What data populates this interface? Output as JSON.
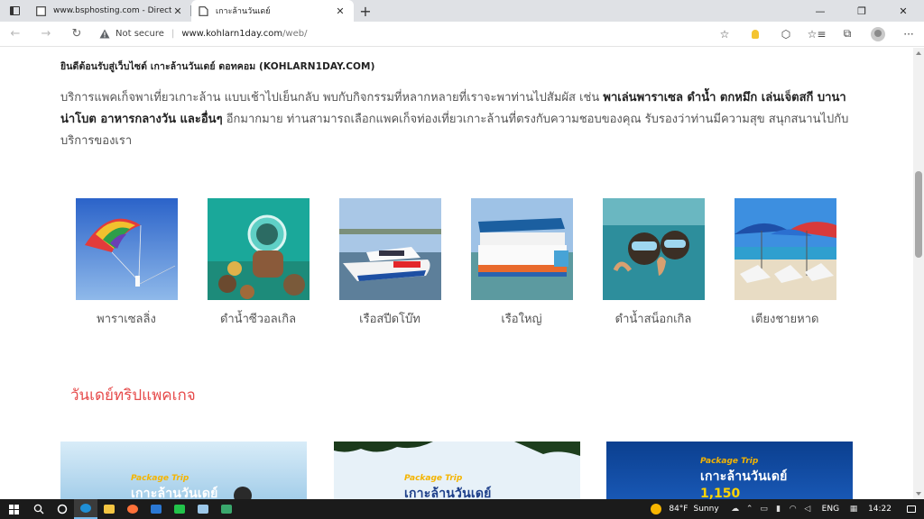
{
  "browser": {
    "tabs": [
      {
        "title": "www.bsphosting.com - DirectAd",
        "active": false,
        "close": "✕"
      },
      {
        "title": "เกาะล้านวันเดย์",
        "active": true,
        "close": "✕"
      }
    ],
    "new_tab": "+",
    "window_controls": {
      "minimize": "—",
      "restore": "❐",
      "close": "✕"
    },
    "nav": {
      "back": "←",
      "forward": "→",
      "reload": "↻"
    },
    "address": {
      "security_label": "Not secure",
      "separator": "|",
      "url_host": "www.kohlarn1day.com",
      "url_path": "/web/"
    },
    "tools": {
      "favorites": "☆",
      "extensions": "⬡",
      "collections": "☆≡",
      "tabs": "⧉",
      "more": "···"
    }
  },
  "page": {
    "welcome": "ยินดีต้อนรับสู่เว็บไซต์ เกาะล้านวันเดย์ ดอทคอม (KOHLARN1DAY.COM)",
    "intro": {
      "part1": "บริการแพคเก็จพาเที่ยวเกาะล้าน แบบเช้าไปเย็นกลับ พบกับกิจกรรมที่หลากหลายที่เราจะพาท่านไปสัมผัส เช่น ",
      "bold": "พาเล่นพาราเซล ดำน้ำ ตกหมึก เล่นเจ็ตสกี บานาน่าโบต อาหารกลางวัน และอื่นๆ",
      "part2": " อีกมากมาย ท่านสามารถเลือกแพคเก็จท่องเที่ยวเกาะล้านที่ตรงกับความชอบของคุณ รับรองว่าท่านมีความสุข สนุกสนานไปกับบริการของเรา"
    },
    "activities": [
      {
        "label": "พาราเซลลิ่ง",
        "icon": "parasailing-photo"
      },
      {
        "label": "ดำน้ำซีวอลเกิล",
        "icon": "sea-walker-photo"
      },
      {
        "label": "เรือสปีดโบ๊ท",
        "icon": "speedboat-photo"
      },
      {
        "label": "เรือใหญ่",
        "icon": "big-boat-photo"
      },
      {
        "label": "ดำน้ำสน็อกเกิล",
        "icon": "snorkeling-photo"
      },
      {
        "label": "เตียงชายหาด",
        "icon": "beach-chairs-photo"
      }
    ],
    "section_title": "วันเดย์ทริปแพคเกจ",
    "packages": [
      {
        "tag": "Package Trip",
        "name": "เกาะล้านวันเดย์"
      },
      {
        "tag": "Package Trip",
        "name": "เกาะล้านวันเดย์"
      },
      {
        "tag": "Package Trip",
        "name": "เกาะล้านวันเดย์",
        "price": "1,150"
      }
    ]
  },
  "taskbar": {
    "weather": {
      "temp": "84°F",
      "condition": "Sunny"
    },
    "lang": "ENG",
    "time": "14:22"
  },
  "colors": {
    "accent_red": "#e64b4b",
    "package_tag": "#f4b400",
    "package_price": "#ffd400"
  }
}
